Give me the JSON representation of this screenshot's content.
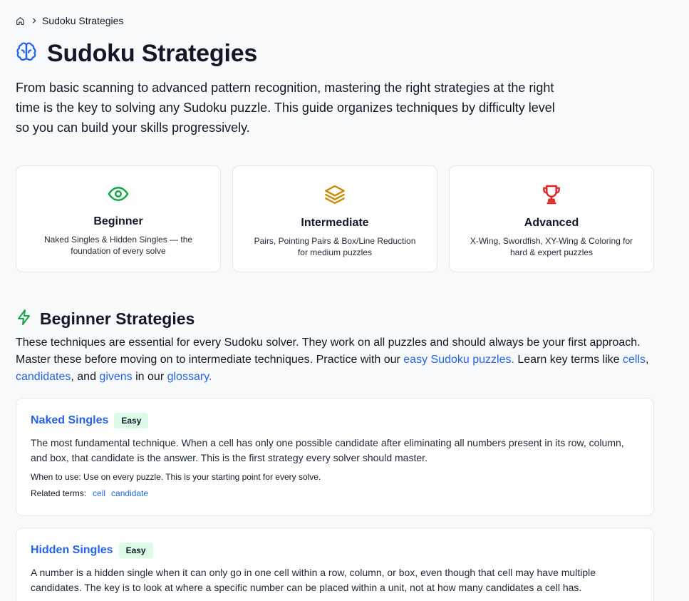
{
  "breadcrumb": {
    "home_icon": "home-icon",
    "separator_icon": "chevron-right-icon",
    "current": "Sudoku Strategies"
  },
  "header": {
    "icon": "brain-icon",
    "title": "Sudoku Strategies",
    "intro": "From basic scanning to advanced pattern recognition, mastering the right strategies at the right time is the key to solving any Sudoku puzzle. This guide organizes techniques by difficulty level so you can build your skills progressively."
  },
  "levels": [
    {
      "icon": "eye-icon",
      "color": "#16a34a",
      "title": "Beginner",
      "desc": "Naked Singles & Hidden Singles — the foundation of every solve"
    },
    {
      "icon": "layers-icon",
      "color": "#ca8a04",
      "title": "Intermediate",
      "desc": "Pairs, Pointing Pairs & Box/Line Reduction for medium puzzles"
    },
    {
      "icon": "trophy-icon",
      "color": "#dc2626",
      "title": "Advanced",
      "desc": "X-Wing, Swordfish, XY-Wing & Coloring for hard & expert puzzles"
    }
  ],
  "beginner_section": {
    "icon": "zap-icon",
    "icon_color": "#16a34a",
    "title": "Beginner Strategies",
    "text_1": "These techniques are essential for every Sudoku solver. They work on all puzzles and should always be your first approach. Master these before moving on to intermediate techniques. Practice with our ",
    "link_easy": "easy Sudoku puzzles.",
    "text_2": " Learn key terms like ",
    "link_cells": "cells",
    "text_3": ", ",
    "link_candidates": "candidates",
    "text_4": ", and ",
    "link_givens": "givens",
    "text_5": " in our ",
    "link_glossary": "glossary."
  },
  "strategies": [
    {
      "name": "Naked Singles",
      "badge": "Easy",
      "desc": "The most fundamental technique. When a cell has only one possible candidate after eliminating all numbers present in its row, column, and box, that candidate is the answer. This is the first strategy every solver should master.",
      "when": "When to use: Use on every puzzle. This is your starting point for every solve.",
      "terms_label": "Related terms:",
      "terms": [
        "cell",
        "candidate"
      ]
    },
    {
      "name": "Hidden Singles",
      "badge": "Easy",
      "desc": "A number is a hidden single when it can only go in one cell within a row, column, or box, even though that cell may have multiple candidates. The key is to look at where a specific number can be placed within a unit, not at how many candidates a cell has."
    }
  ],
  "colors": {
    "link": "#2563eb",
    "badge_bg": "#dcfce7",
    "card_border": "#e5e7eb",
    "page_bg": "#f8f9fb"
  }
}
